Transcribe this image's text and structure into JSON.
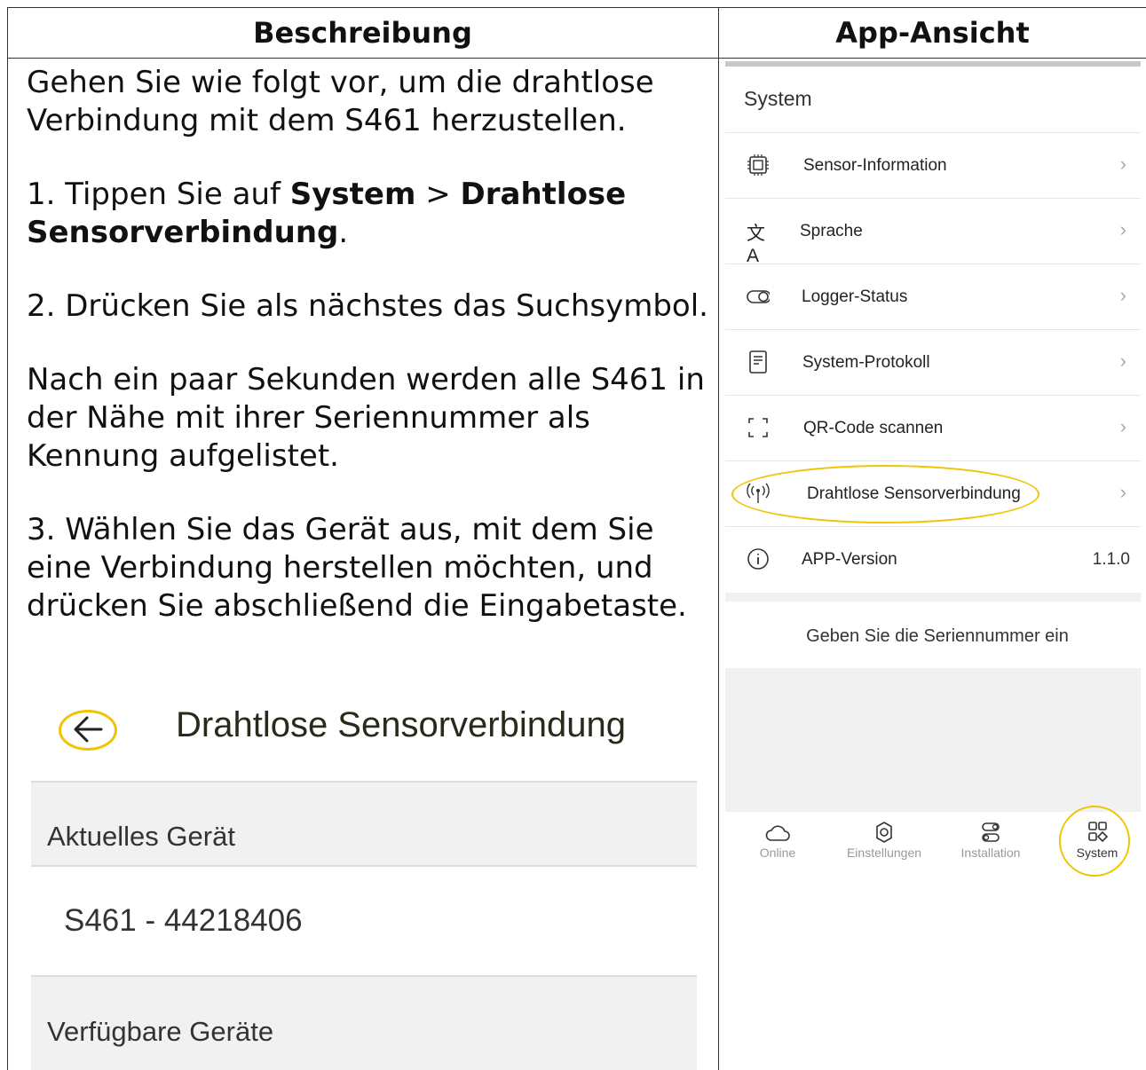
{
  "table": {
    "col1_header": "Beschreibung",
    "col2_header": "App-Ansicht"
  },
  "description": {
    "intro": "Gehen Sie wie folgt vor, um die drahtlose Verbindung mit dem S461 herzustellen.",
    "step1_prefix": "1. Tippen Sie auf ",
    "step1_bold1": "System",
    "step1_sep": " > ",
    "step1_bold2": "Drahtlose Sensorverbindung",
    "step1_suffix": ".",
    "step2": "2. Drücken Sie als nächstes das Suchsymbol.",
    "note": "Nach ein paar Sekunden werden alle S461 in der Nähe mit ihrer Seriennummer als Kennung aufgelistet.",
    "step3": "3. Wählen Sie das Gerät aus, mit dem Sie eine Verbindung herstellen möchten, und drücken Sie abschließend die Eingabetaste."
  },
  "mockup": {
    "title": "Drahtlose Sensorverbindung",
    "current_label": "Aktuelles Gerät",
    "current_device": "S461 - 44218406",
    "available_label": "Verfügbare Geräte",
    "highlight_color": "#f0c400"
  },
  "app": {
    "section_title": "System",
    "menu": [
      {
        "icon": "chip-icon",
        "label": "Sensor-Information"
      },
      {
        "icon": "translate-icon",
        "label": "Sprache"
      },
      {
        "icon": "toggle-icon",
        "label": "Logger-Status"
      },
      {
        "icon": "document-icon",
        "label": "System-Protokoll"
      },
      {
        "icon": "scan-icon",
        "label": "QR-Code scannen"
      },
      {
        "icon": "antenna-icon",
        "label": "Drahtlose Sensorverbindung"
      },
      {
        "icon": "info-icon",
        "label": "APP-Version",
        "value": "1.1.0"
      }
    ],
    "serial_hint": "Geben Sie die Seriennummer ein",
    "tabs": [
      {
        "icon": "cloud-icon",
        "label": "Online"
      },
      {
        "icon": "gear-icon",
        "label": "Einstellungen"
      },
      {
        "icon": "toggles-icon",
        "label": "Installation"
      },
      {
        "icon": "grid-icon",
        "label": "System"
      }
    ]
  }
}
